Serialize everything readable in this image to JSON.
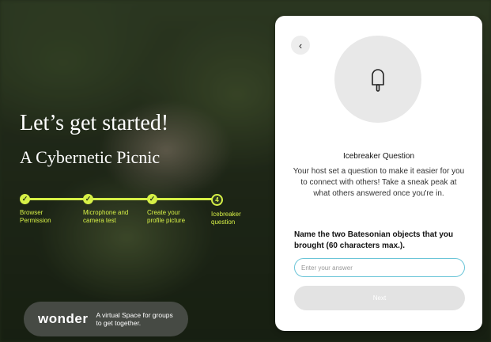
{
  "hero": {
    "title": "Let’s get started!",
    "subtitle": "A Cybernetic Picnic"
  },
  "steps": [
    {
      "label": "Browser Permission",
      "status": "done"
    },
    {
      "label": "Microphone and camera test",
      "status": "done"
    },
    {
      "label": "Create your profile picture",
      "status": "done"
    },
    {
      "label": "Icebreaker question",
      "status": "current",
      "number": "4"
    }
  ],
  "brand": {
    "logo": "wonder",
    "tagline": "A virtual Space for groups to get together."
  },
  "card": {
    "back_icon": "chevron-left-icon",
    "back_glyph": "‹",
    "illustration_icon": "popsicle-icon",
    "title": "Icebreaker Question",
    "description": "Your host set a question to make it easier for you to connect with others! Take a sneak peak at what others answered once you're in.",
    "question": "Name the two Batesonian objects that you brought (60 characters max.).",
    "input": {
      "placeholder": "Enter your answer",
      "value": ""
    },
    "next_label": "Next"
  },
  "colors": {
    "accent": "#d6f046",
    "input_border": "#6bc5d8",
    "disabled_button": "#e3e3e3"
  }
}
